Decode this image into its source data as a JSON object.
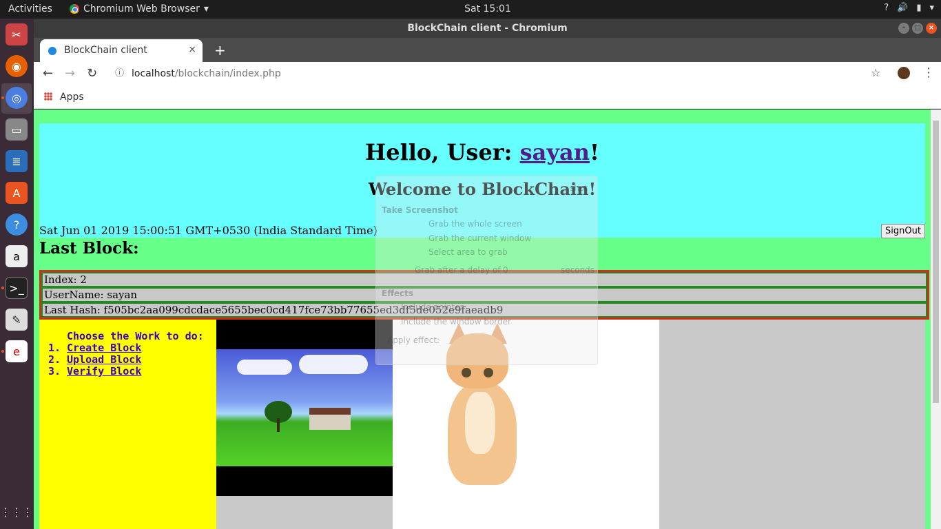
{
  "system": {
    "activities": "Activities",
    "app_name": "Chromium Web Browser",
    "clock": "Sat 15:01",
    "tray_icons": [
      "help-icon",
      "volume-icon",
      "battery-icon",
      "system-menu-chevron-icon"
    ]
  },
  "window": {
    "title": "BlockChain client - Chromium"
  },
  "tabs": [
    {
      "label": "BlockChain client",
      "close": "×"
    }
  ],
  "toolbar": {
    "url_host": "localhost",
    "url_path": "/blockchain/index.php"
  },
  "bookmarks": {
    "apps_label": "Apps"
  },
  "page": {
    "hello_prefix": "Hello, User: ",
    "username_link": "sayan",
    "hello_suffix": "!",
    "welcome": "Welcome to BlockChain!",
    "datetime": "Sat Jun 01 2019 15:00:51 GMT+0530 (India Standard Time)",
    "signout_label": "SignOut",
    "last_block_heading": "Last Block:",
    "block": {
      "index": "Index: 2",
      "username": "UserName: sayan",
      "last_hash": "Last Hash: f505bc2aa099cdcdace5655bec0cd417fce73bb77655ed3df5de052e9faeadb9"
    },
    "menu": {
      "heading": "Choose the Work to do:",
      "items": [
        {
          "num": "1.",
          "label": "Create Block"
        },
        {
          "num": "2.",
          "label": "Upload Block"
        },
        {
          "num": "3.",
          "label": "Verify Block"
        }
      ]
    }
  },
  "ghost_dialog": {
    "title_fragment": "shot",
    "section1": "Take Screenshot",
    "opt1": "Grab the whole screen",
    "opt2": "Grab the current window",
    "opt3": "Select area to grab",
    "delay_label": "Grab after a delay of",
    "delay_value": "0",
    "delay_unit": "seconds",
    "section2": "Effects",
    "eff1": "Include pointer",
    "eff2": "Include the window border",
    "eff3": "Apply effect:"
  },
  "colors": {
    "page_bg": "#66ff88",
    "header_bg": "#66ffff",
    "menu_bg": "#ffff00",
    "link": "#551a8b",
    "block_border": "#d52b1e",
    "row_border": "#1f8b1f"
  }
}
